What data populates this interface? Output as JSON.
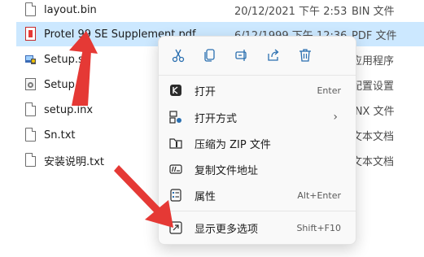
{
  "files": [
    {
      "name": "layout.bin",
      "date": "20/12/2021 下午 2:53",
      "type": "BIN 文件"
    },
    {
      "name": "Protel 99 SE Supplement.pdf",
      "date": "6/12/1999 下午 12:36",
      "type": "PDF 文件"
    },
    {
      "name": "Setup.s",
      "date": "",
      "type": "应用程序"
    },
    {
      "name": "Setup.in",
      "date": "",
      "type": "配置设置"
    },
    {
      "name": "setup.inx",
      "date": "",
      "type": "INX 文件"
    },
    {
      "name": "Sn.txt",
      "date": "",
      "type": "文本文档"
    },
    {
      "name": "安装说明.txt",
      "date": "",
      "type": "文本文档"
    }
  ],
  "context_menu": {
    "toolbar": [
      "cut-icon",
      "copy-icon",
      "rename-icon",
      "share-icon",
      "delete-icon"
    ],
    "items": [
      {
        "label": "打开",
        "accel": "Enter",
        "icon": "open-icon"
      },
      {
        "label": "打开方式",
        "accel": "",
        "icon": "open-with-icon"
      },
      {
        "label": "压缩为 ZIP 文件",
        "accel": "",
        "icon": "zip-icon"
      },
      {
        "label": "复制文件地址",
        "accel": "",
        "icon": "copy-path-icon"
      },
      {
        "label": "属性",
        "accel": "Alt+Enter",
        "icon": "properties-icon"
      },
      {
        "label": "显示更多选项",
        "accel": "Shift+F10",
        "icon": "more-options-icon"
      }
    ],
    "submenu_chevron": "›"
  },
  "colors": {
    "selection": "#cce8ff",
    "arrow": "#e53935"
  }
}
